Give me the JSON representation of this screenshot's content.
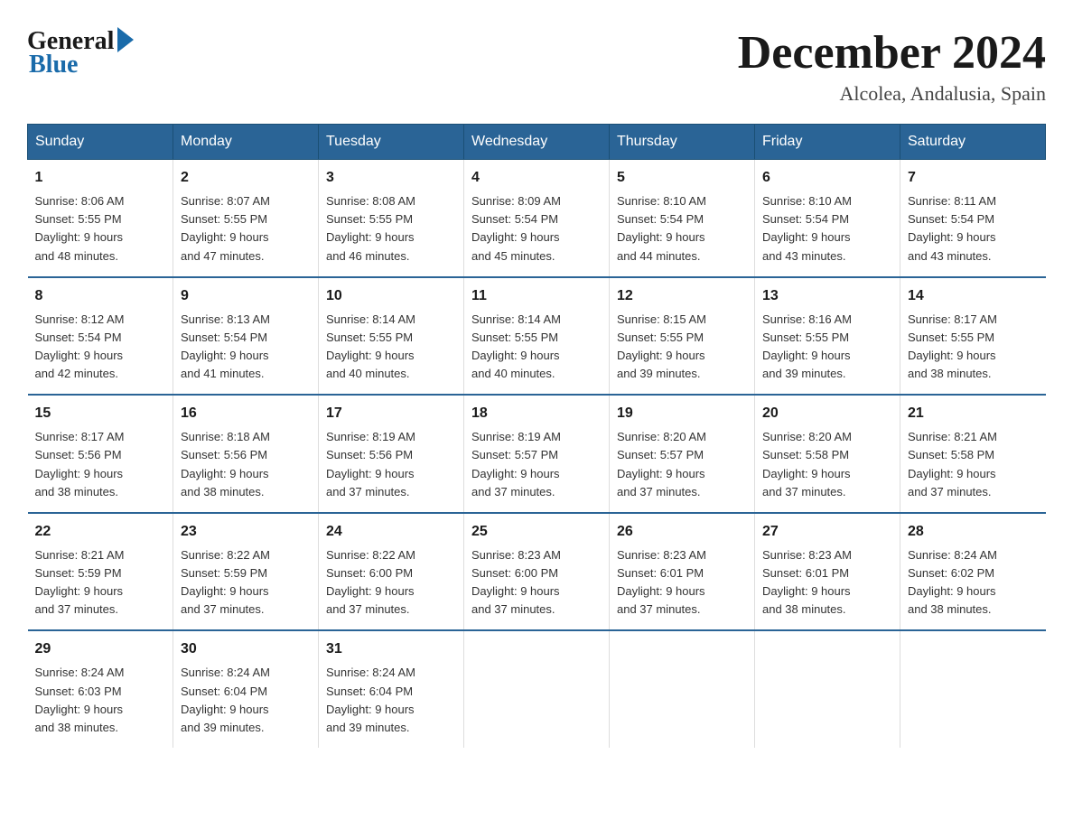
{
  "logo": {
    "general": "General",
    "blue": "Blue"
  },
  "title": "December 2024",
  "location": "Alcolea, Andalusia, Spain",
  "days_of_week": [
    "Sunday",
    "Monday",
    "Tuesday",
    "Wednesday",
    "Thursday",
    "Friday",
    "Saturday"
  ],
  "weeks": [
    [
      {
        "day": "1",
        "sunrise": "8:06 AM",
        "sunset": "5:55 PM",
        "daylight": "9 hours and 48 minutes."
      },
      {
        "day": "2",
        "sunrise": "8:07 AM",
        "sunset": "5:55 PM",
        "daylight": "9 hours and 47 minutes."
      },
      {
        "day": "3",
        "sunrise": "8:08 AM",
        "sunset": "5:55 PM",
        "daylight": "9 hours and 46 minutes."
      },
      {
        "day": "4",
        "sunrise": "8:09 AM",
        "sunset": "5:54 PM",
        "daylight": "9 hours and 45 minutes."
      },
      {
        "day": "5",
        "sunrise": "8:10 AM",
        "sunset": "5:54 PM",
        "daylight": "9 hours and 44 minutes."
      },
      {
        "day": "6",
        "sunrise": "8:10 AM",
        "sunset": "5:54 PM",
        "daylight": "9 hours and 43 minutes."
      },
      {
        "day": "7",
        "sunrise": "8:11 AM",
        "sunset": "5:54 PM",
        "daylight": "9 hours and 43 minutes."
      }
    ],
    [
      {
        "day": "8",
        "sunrise": "8:12 AM",
        "sunset": "5:54 PM",
        "daylight": "9 hours and 42 minutes."
      },
      {
        "day": "9",
        "sunrise": "8:13 AM",
        "sunset": "5:54 PM",
        "daylight": "9 hours and 41 minutes."
      },
      {
        "day": "10",
        "sunrise": "8:14 AM",
        "sunset": "5:55 PM",
        "daylight": "9 hours and 40 minutes."
      },
      {
        "day": "11",
        "sunrise": "8:14 AM",
        "sunset": "5:55 PM",
        "daylight": "9 hours and 40 minutes."
      },
      {
        "day": "12",
        "sunrise": "8:15 AM",
        "sunset": "5:55 PM",
        "daylight": "9 hours and 39 minutes."
      },
      {
        "day": "13",
        "sunrise": "8:16 AM",
        "sunset": "5:55 PM",
        "daylight": "9 hours and 39 minutes."
      },
      {
        "day": "14",
        "sunrise": "8:17 AM",
        "sunset": "5:55 PM",
        "daylight": "9 hours and 38 minutes."
      }
    ],
    [
      {
        "day": "15",
        "sunrise": "8:17 AM",
        "sunset": "5:56 PM",
        "daylight": "9 hours and 38 minutes."
      },
      {
        "day": "16",
        "sunrise": "8:18 AM",
        "sunset": "5:56 PM",
        "daylight": "9 hours and 38 minutes."
      },
      {
        "day": "17",
        "sunrise": "8:19 AM",
        "sunset": "5:56 PM",
        "daylight": "9 hours and 37 minutes."
      },
      {
        "day": "18",
        "sunrise": "8:19 AM",
        "sunset": "5:57 PM",
        "daylight": "9 hours and 37 minutes."
      },
      {
        "day": "19",
        "sunrise": "8:20 AM",
        "sunset": "5:57 PM",
        "daylight": "9 hours and 37 minutes."
      },
      {
        "day": "20",
        "sunrise": "8:20 AM",
        "sunset": "5:58 PM",
        "daylight": "9 hours and 37 minutes."
      },
      {
        "day": "21",
        "sunrise": "8:21 AM",
        "sunset": "5:58 PM",
        "daylight": "9 hours and 37 minutes."
      }
    ],
    [
      {
        "day": "22",
        "sunrise": "8:21 AM",
        "sunset": "5:59 PM",
        "daylight": "9 hours and 37 minutes."
      },
      {
        "day": "23",
        "sunrise": "8:22 AM",
        "sunset": "5:59 PM",
        "daylight": "9 hours and 37 minutes."
      },
      {
        "day": "24",
        "sunrise": "8:22 AM",
        "sunset": "6:00 PM",
        "daylight": "9 hours and 37 minutes."
      },
      {
        "day": "25",
        "sunrise": "8:23 AM",
        "sunset": "6:00 PM",
        "daylight": "9 hours and 37 minutes."
      },
      {
        "day": "26",
        "sunrise": "8:23 AM",
        "sunset": "6:01 PM",
        "daylight": "9 hours and 37 minutes."
      },
      {
        "day": "27",
        "sunrise": "8:23 AM",
        "sunset": "6:01 PM",
        "daylight": "9 hours and 38 minutes."
      },
      {
        "day": "28",
        "sunrise": "8:24 AM",
        "sunset": "6:02 PM",
        "daylight": "9 hours and 38 minutes."
      }
    ],
    [
      {
        "day": "29",
        "sunrise": "8:24 AM",
        "sunset": "6:03 PM",
        "daylight": "9 hours and 38 minutes."
      },
      {
        "day": "30",
        "sunrise": "8:24 AM",
        "sunset": "6:04 PM",
        "daylight": "9 hours and 39 minutes."
      },
      {
        "day": "31",
        "sunrise": "8:24 AM",
        "sunset": "6:04 PM",
        "daylight": "9 hours and 39 minutes."
      },
      null,
      null,
      null,
      null
    ]
  ],
  "labels": {
    "sunrise": "Sunrise:",
    "sunset": "Sunset:",
    "daylight": "Daylight:"
  }
}
